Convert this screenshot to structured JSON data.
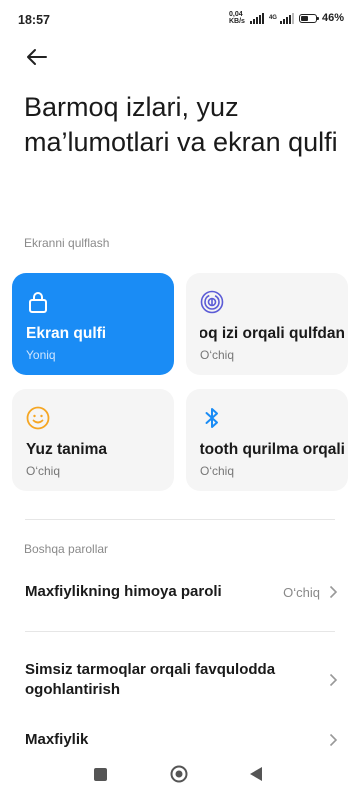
{
  "status_bar": {
    "time": "18:57",
    "net_speed_value": "0,04",
    "net_speed_unit": "KB/s",
    "network_type": "4G",
    "battery_percent": "46",
    "battery_level": 0.46
  },
  "title": "Barmoq izlari, yuz ma’lumotlari va ekran qulfi",
  "sections": {
    "screen_lock_label": "Ekranni qulflash",
    "other_passwords_label": "Boshqa parollar"
  },
  "cards": [
    {
      "name": "Ekran qulfi",
      "state": "Yoniq",
      "icon": "lock-icon",
      "active": true
    },
    {
      "name": "Barmoq izi orqali qulfdan",
      "state": "O‘chiq",
      "icon": "fingerprint-icon",
      "active": false
    },
    {
      "name": "Yuz tanima",
      "state": "O‘chiq",
      "icon": "face-icon",
      "active": false
    },
    {
      "name": "Bluetooth qurilma orqali",
      "state": "O‘chiq",
      "icon": "bluetooth-icon",
      "active": false
    }
  ],
  "rows": [
    {
      "label": "Maxfiylikning himoya paroli",
      "value": "O‘chiq"
    },
    {
      "label": "Simsiz tarmoqlar orqali favqulodda ogohlantirish",
      "value": ""
    },
    {
      "label": "Maxfiylik",
      "value": ""
    }
  ],
  "colors": {
    "accent": "#1a8cf5",
    "card_bg": "#f5f5f5",
    "face_icon": "#f5a623",
    "fingerprint_icon": "#5b5bd6",
    "bluetooth_icon": "#1a8cf5"
  }
}
